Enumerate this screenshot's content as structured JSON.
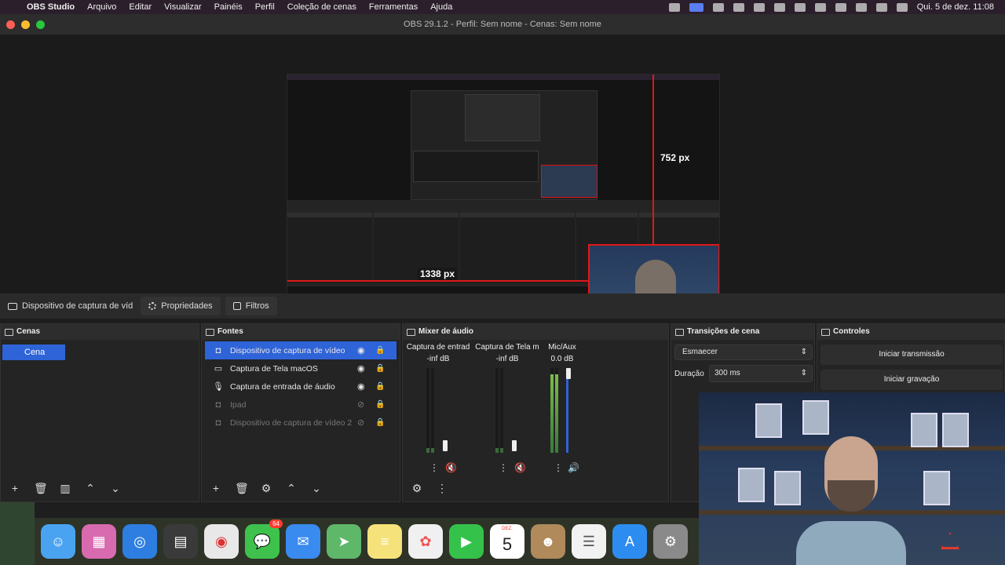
{
  "menubar": {
    "apple_icon": "apple-icon",
    "items": [
      "OBS Studio",
      "Arquivo",
      "Editar",
      "Visualizar",
      "Painéis",
      "Perfil",
      "Coleção de cenas",
      "Ferramentas",
      "Ajuda"
    ],
    "datetime": "Qui. 5 de dez.  11:08"
  },
  "window": {
    "title": "OBS 29.1.2 - Perfil: Sem nome - Cenas: Sem nome"
  },
  "preview": {
    "height_label": "752 px",
    "width_label": "1338 px"
  },
  "source_toolbar": {
    "source_name": "Dispositivo de captura de víd",
    "properties_label": "Propriedades",
    "filters_label": "Filtros"
  },
  "scenes": {
    "title": "Cenas",
    "items": [
      "Cena"
    ]
  },
  "sources": {
    "title": "Fontes",
    "items": [
      {
        "label": "Dispositivo de captura de vídeo",
        "icon": "camera-icon"
      },
      {
        "label": "Captura de Tela macOS",
        "icon": "monitor-icon"
      },
      {
        "label": "Captura de entrada de áudio",
        "icon": "microphone-icon"
      },
      {
        "label": "Ipad",
        "icon": "camera-icon"
      },
      {
        "label": "Dispositivo de captura de vídeo 2",
        "icon": "camera-icon"
      }
    ]
  },
  "mixer": {
    "title": "Mixer de áudio",
    "channels": [
      {
        "name": "Captura de entrad",
        "db": "-inf dB"
      },
      {
        "name": "Captura de Tela m",
        "db": "-inf dB"
      },
      {
        "name": "Mic/Aux",
        "db": "0.0 dB"
      }
    ]
  },
  "transitions": {
    "title": "Transições de cena",
    "selected": "Esmaecer",
    "duration_label": "Duração",
    "duration_value": "300 ms"
  },
  "controls": {
    "title": "Controles",
    "start_stream": "Iniciar transmissão",
    "start_recording": "Iniciar gravação"
  },
  "dock": {
    "messages_badge": "64",
    "calendar_month": "DEZ.",
    "calendar_day": "5"
  },
  "colors": {
    "accent": "#2f63d8",
    "guide_red": "#e01818"
  }
}
